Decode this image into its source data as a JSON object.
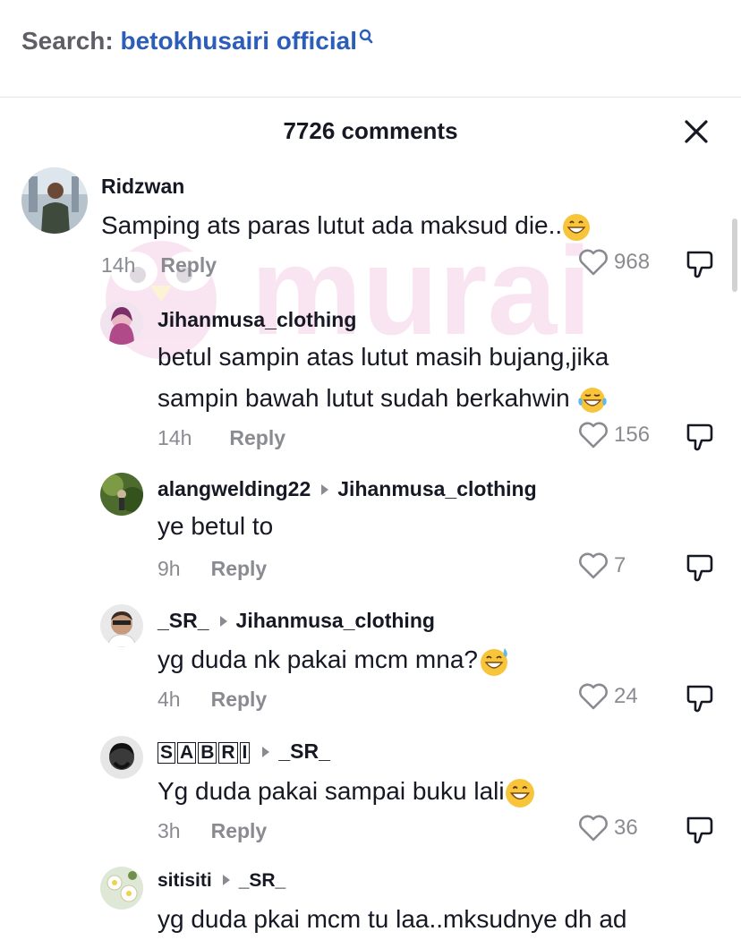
{
  "search": {
    "prefix": "Search:",
    "query": "betokhusairi official"
  },
  "panel": {
    "comment_count": "7726 comments"
  },
  "watermark": {
    "text": "murai"
  },
  "comments": [
    {
      "username": "Ridzwan",
      "text": "Samping ats paras lutut ada maksud die..",
      "emoji": "grinning-face",
      "time": "14h",
      "reply_label": "Reply",
      "likes": "968"
    },
    {
      "username": "Jihanmusa_clothing",
      "text_line1": "betul sampin atas lutut masih bujang,jika",
      "text_line2": "sampin bawah lutut sudah berkahwin",
      "emoji": "tears-of-joy",
      "time": "14h",
      "reply_label": "Reply",
      "likes": "156"
    },
    {
      "username": "alangwelding22",
      "reply_to": "Jihanmusa_clothing",
      "text": "ye betul to",
      "time": "9h",
      "reply_label": "Reply",
      "likes": "7"
    },
    {
      "username": "_SR_",
      "reply_to": "Jihanmusa_clothing",
      "text": "yg duda nk pakai mcm mna?",
      "emoji": "grinning-sweat",
      "time": "4h",
      "reply_label": "Reply",
      "likes": "24"
    },
    {
      "username_letters": [
        "S",
        "A",
        "B",
        "R",
        "I"
      ],
      "reply_to": "_SR_",
      "text": "Yg duda pakai sampai buku lali",
      "emoji": "grinning-face",
      "time": "3h",
      "reply_label": "Reply",
      "likes": "36"
    },
    {
      "username": "sitisiti",
      "reply_to": "_SR_",
      "text": "yg duda pkai mcm tu laa..mksudnye dh ad"
    }
  ]
}
